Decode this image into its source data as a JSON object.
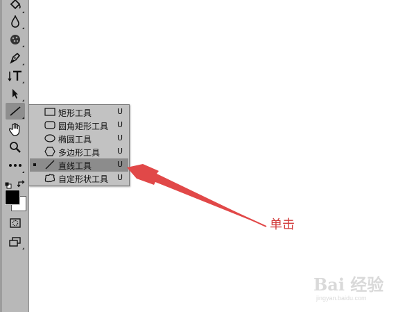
{
  "toolbar": {
    "tools": [
      {
        "name": "paint-bucket-tool",
        "icon": "paint-bucket-icon"
      },
      {
        "name": "blur-tool",
        "icon": "droplet-icon"
      },
      {
        "name": "sponge-tool",
        "icon": "sponge-icon"
      },
      {
        "name": "pen-tool",
        "icon": "pen-icon"
      },
      {
        "name": "type-tool",
        "icon": "type-icon"
      },
      {
        "name": "path-selection-tool",
        "icon": "arrow-cursor-icon"
      },
      {
        "name": "line-tool",
        "icon": "line-icon",
        "selected": true
      },
      {
        "name": "hand-tool",
        "icon": "hand-icon"
      },
      {
        "name": "zoom-tool",
        "icon": "magnifier-icon"
      },
      {
        "name": "more-tools",
        "icon": "ellipsis-icon"
      },
      {
        "name": "default-colors",
        "icon": "default-colors-icon"
      },
      {
        "name": "swap-colors",
        "icon": "swap-arrow-icon"
      },
      {
        "name": "color-swatches",
        "foreground": "#000000",
        "background": "#ffffff"
      },
      {
        "name": "quick-mask",
        "icon": "quick-mask-icon"
      },
      {
        "name": "screen-mode",
        "icon": "screen-mode-icon"
      }
    ]
  },
  "flyout": {
    "items": [
      {
        "label": "矩形工具",
        "shortcut": "U",
        "icon": "rectangle-icon"
      },
      {
        "label": "圆角矩形工具",
        "shortcut": "U",
        "icon": "rounded-rectangle-icon"
      },
      {
        "label": "椭圆工具",
        "shortcut": "U",
        "icon": "ellipse-icon"
      },
      {
        "label": "多边形工具",
        "shortcut": "U",
        "icon": "polygon-icon"
      },
      {
        "label": "直线工具",
        "shortcut": "U",
        "icon": "line-icon",
        "active": true
      },
      {
        "label": "自定形状工具",
        "shortcut": "U",
        "icon": "custom-shape-icon"
      }
    ]
  },
  "annotation": {
    "text": "单击",
    "color": "#d23b3b"
  },
  "watermark": {
    "logo": "Bai 经验",
    "url": "jingyan.baidu.com"
  }
}
